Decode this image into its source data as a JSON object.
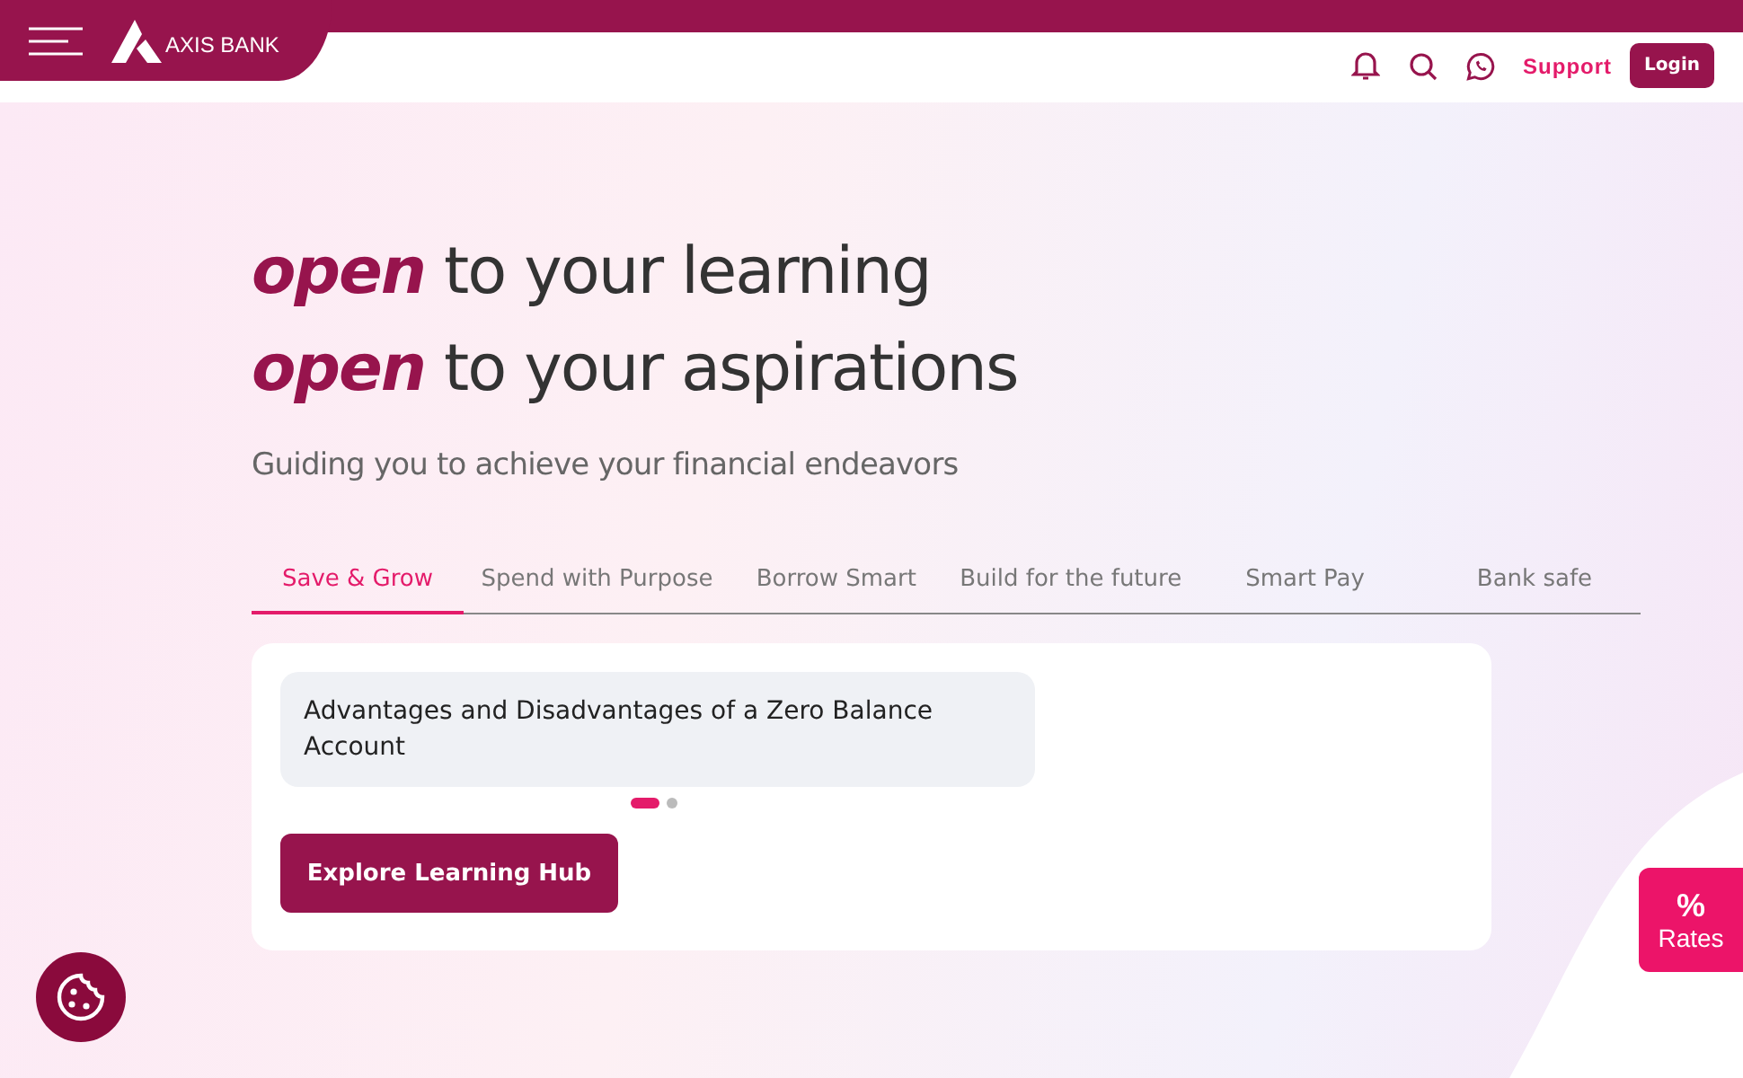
{
  "header": {
    "logo_text": "AXIS BANK",
    "support": "Support",
    "login": "Login"
  },
  "headline": [
    {
      "emphasis": "open",
      "text": "to your learning"
    },
    {
      "emphasis": "open",
      "text": "to your aspirations"
    }
  ],
  "subtitle": "Guiding you to achieve your financial endeavors",
  "tabs": [
    {
      "label": "Save & Grow",
      "selected": true
    },
    {
      "label": "Spend with Purpose",
      "selected": false
    },
    {
      "label": "Borrow Smart",
      "selected": false
    },
    {
      "label": "Build for the future",
      "selected": false
    },
    {
      "label": "Smart Pay",
      "selected": false
    },
    {
      "label": "Bank safe",
      "selected": false
    }
  ],
  "articles": [
    {
      "title": "Advantages and Disadvantages of a Zero Balance Account"
    }
  ],
  "carousel_dots": [
    {
      "selected": true
    },
    {
      "selected": false
    }
  ],
  "explore_button": "Explore Learning Hub",
  "rates": {
    "symbol": "%",
    "label": "Rates"
  }
}
